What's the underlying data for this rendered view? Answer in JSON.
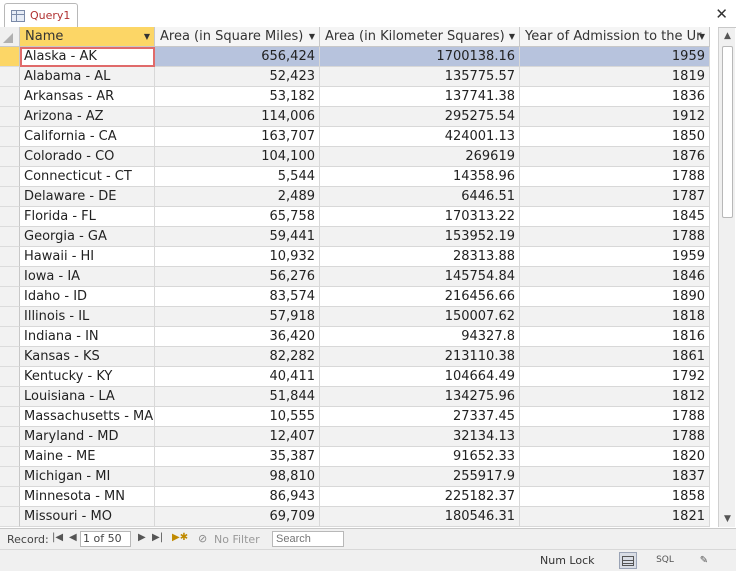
{
  "tab": {
    "title": "Query1",
    "close_glyph": "✕"
  },
  "columns": [
    {
      "label": "Name"
    },
    {
      "label": "Area (in Square Miles)"
    },
    {
      "label": "Area (in Kilometer Squares)"
    },
    {
      "label": "Year of Admission to the Ur"
    }
  ],
  "rows": [
    [
      "Alaska - AK",
      "656,424",
      "1700138.16",
      "1959"
    ],
    [
      "Alabama - AL",
      "52,423",
      "135775.57",
      "1819"
    ],
    [
      "Arkansas - AR",
      "53,182",
      "137741.38",
      "1836"
    ],
    [
      "Arizona - AZ",
      "114,006",
      "295275.54",
      "1912"
    ],
    [
      "California - CA",
      "163,707",
      "424001.13",
      "1850"
    ],
    [
      "Colorado - CO",
      "104,100",
      "269619",
      "1876"
    ],
    [
      "Connecticut - CT",
      "5,544",
      "14358.96",
      "1788"
    ],
    [
      "Delaware - DE",
      "2,489",
      "6446.51",
      "1787"
    ],
    [
      "Florida - FL",
      "65,758",
      "170313.22",
      "1845"
    ],
    [
      "Georgia - GA",
      "59,441",
      "153952.19",
      "1788"
    ],
    [
      "Hawaii - HI",
      "10,932",
      "28313.88",
      "1959"
    ],
    [
      "Iowa - IA",
      "56,276",
      "145754.84",
      "1846"
    ],
    [
      "Idaho - ID",
      "83,574",
      "216456.66",
      "1890"
    ],
    [
      "Illinois - IL",
      "57,918",
      "150007.62",
      "1818"
    ],
    [
      "Indiana - IN",
      "36,420",
      "94327.8",
      "1816"
    ],
    [
      "Kansas - KS",
      "82,282",
      "213110.38",
      "1861"
    ],
    [
      "Kentucky - KY",
      "40,411",
      "104664.49",
      "1792"
    ],
    [
      "Louisiana - LA",
      "51,844",
      "134275.96",
      "1812"
    ],
    [
      "Massachusetts - MA",
      "10,555",
      "27337.45",
      "1788"
    ],
    [
      "Maryland - MD",
      "12,407",
      "32134.13",
      "1788"
    ],
    [
      "Maine - ME",
      "35,387",
      "91652.33",
      "1820"
    ],
    [
      "Michigan - MI",
      "98,810",
      "255917.9",
      "1837"
    ],
    [
      "Minnesota - MN",
      "86,943",
      "225182.37",
      "1858"
    ],
    [
      "Missouri - MO",
      "69,709",
      "180546.31",
      "1821"
    ]
  ],
  "navigation": {
    "record_label": "Record:",
    "record_position": "1 of 50",
    "filter_label": "No Filter",
    "search_placeholder": "Search"
  },
  "status": {
    "num_lock": "Num Lock",
    "sql_label": "SQL"
  },
  "colors": {
    "selected_header": "#fcd666",
    "current_row_highlight": "#b7c3dd",
    "tab_title": "#b03030"
  }
}
